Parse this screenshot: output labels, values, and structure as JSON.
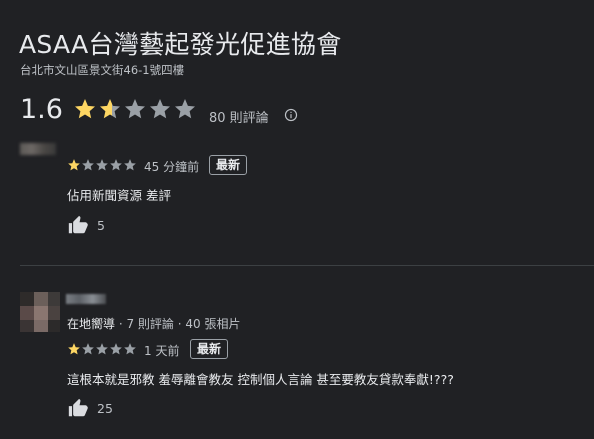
{
  "place": {
    "title": "ASAA台灣藝起發光促進協會",
    "address": "台北市文山區景文街46-1號四樓",
    "rating": "1.6",
    "rating_value": 1.6,
    "review_count": "80 則評論",
    "star_color": "#fdd663",
    "empty_star_color": "#9aa0a6"
  },
  "reviews": [
    {
      "stars": 1,
      "time": "45 分鐘前",
      "badge": "最新",
      "text": "佔用新聞資源 差評",
      "likes": "5"
    },
    {
      "guide_label": "在地嚮導",
      "guide_stats": "· 7 則評論 · 40 張相片",
      "stars": 1,
      "time": "1 天前",
      "badge": "最新",
      "text": "這根本就是邪教 羞辱離會教友 控制個人言論 甚至要教友貸款奉獻!???",
      "likes": "25"
    }
  ]
}
